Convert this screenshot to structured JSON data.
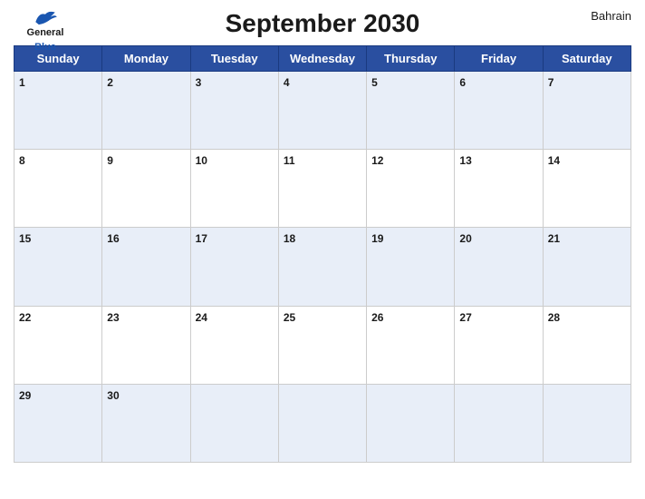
{
  "calendar": {
    "title": "September 2030",
    "country": "Bahrain",
    "logo": {
      "line1": "General",
      "line2": "Blue"
    },
    "days": [
      "Sunday",
      "Monday",
      "Tuesday",
      "Wednesday",
      "Thursday",
      "Friday",
      "Saturday"
    ],
    "weeks": [
      [
        1,
        2,
        3,
        4,
        5,
        6,
        7
      ],
      [
        8,
        9,
        10,
        11,
        12,
        13,
        14
      ],
      [
        15,
        16,
        17,
        18,
        19,
        20,
        21
      ],
      [
        22,
        23,
        24,
        25,
        26,
        27,
        28
      ],
      [
        29,
        30,
        null,
        null,
        null,
        null,
        null
      ]
    ]
  }
}
